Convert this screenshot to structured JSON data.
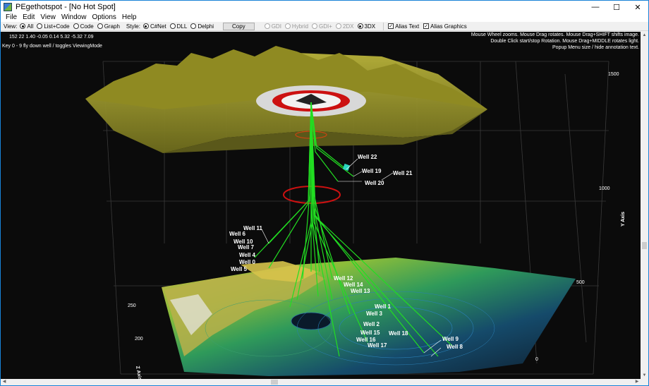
{
  "window": {
    "title": "PEgethotspot - [No Hot Spot]",
    "controls": {
      "minimize": "—",
      "maximize": "☐",
      "close": "✕"
    }
  },
  "menu": [
    "File",
    "Edit",
    "View",
    "Window",
    "Options",
    "Help"
  ],
  "toolbar": {
    "view_label": "View:",
    "view_options": [
      {
        "label": "All",
        "selected": true
      },
      {
        "label": "List+Code",
        "selected": false
      },
      {
        "label": "Code",
        "selected": false
      },
      {
        "label": "Graph",
        "selected": false
      }
    ],
    "style_label": "Style:",
    "style_options": [
      {
        "label": "C#Net",
        "selected": true
      },
      {
        "label": "DLL",
        "selected": false
      },
      {
        "label": "Delphi",
        "selected": false
      }
    ],
    "copy_label": "Copy",
    "render_options": [
      {
        "label": "GDI",
        "selected": false,
        "enabled": false
      },
      {
        "label": "Hybrid",
        "selected": false,
        "enabled": false
      },
      {
        "label": "GDI+",
        "selected": false,
        "enabled": false
      },
      {
        "label": "2DX",
        "selected": false,
        "enabled": false
      },
      {
        "label": "3DX",
        "selected": true,
        "enabled": true
      }
    ],
    "checkboxes": [
      {
        "label": "Alias Text",
        "checked": true
      },
      {
        "label": "Alias Graphics",
        "checked": true
      }
    ]
  },
  "viewport": {
    "values_line": "152  22  1.40  -0.05  0.14  5.32  -5.32  7.09",
    "hint_line": "Key 0 - 9 fly down well / toggles ViewingMode",
    "help_lines": [
      "Mouse Wheel zooms. Mouse Drag rotates. Mouse Drag+SHIFT shifts image.",
      "Double Click start/stop Rotation. Mouse Drag+MIDDLE rotates light.",
      "Popup Menu size / hide annotation text."
    ],
    "y_axis": {
      "title": "Y Axis",
      "ticks": [
        "1500",
        "1000",
        "500",
        "0"
      ]
    },
    "z_axis": {
      "title": "Z Axis",
      "ticks": [
        "250",
        "200"
      ]
    },
    "wells": [
      "Well 22",
      "Well 19",
      "Well 21",
      "Well 20",
      "Well 11",
      "Well 6",
      "Well 10",
      "Well 7",
      "Well 4",
      "Well 0",
      "Well 5",
      "Well 12",
      "Well 14",
      "Well 13",
      "Well 1",
      "Well 3",
      "Well 2",
      "Well 15",
      "Well 18",
      "Well 16",
      "Well 17",
      "Well 9",
      "Well 8"
    ],
    "colors": {
      "well_line": "#22dd22",
      "surface": "#9a9a2a",
      "ring": "#cc1111",
      "background": "#0b0b0b"
    }
  }
}
